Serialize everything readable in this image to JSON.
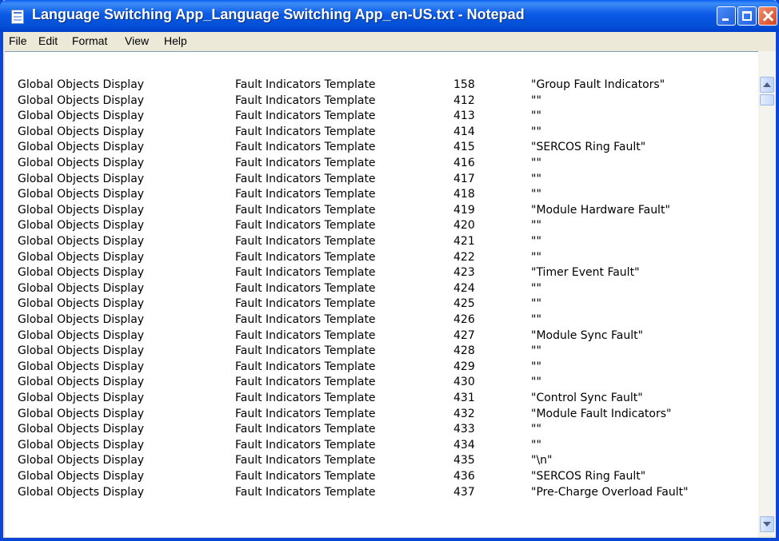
{
  "window": {
    "title": "Language Switching App_Language Switching App_en-US.txt - Notepad",
    "buttons": [
      "minimize",
      "maximize",
      "close"
    ]
  },
  "menu": [
    "File",
    "Edit",
    "Format",
    "View",
    "Help"
  ],
  "colors": {
    "titlebar": "#0b5ae6",
    "close_button": "#d8431c",
    "menubar": "#ece9d8"
  },
  "content": {
    "lines": [
      [
        "Global Objects Display",
        "Fault Indicators Template",
        "158",
        "\"Group Fault Indicators\""
      ],
      [
        "Global Objects Display",
        "Fault Indicators Template",
        "412",
        "\"\""
      ],
      [
        "Global Objects Display",
        "Fault Indicators Template",
        "413",
        "\"\""
      ],
      [
        "Global Objects Display",
        "Fault Indicators Template",
        "414",
        "\"\""
      ],
      [
        "Global Objects Display",
        "Fault Indicators Template",
        "415",
        "\"SERCOS Ring Fault\""
      ],
      [
        "Global Objects Display",
        "Fault Indicators Template",
        "416",
        "\"\""
      ],
      [
        "Global Objects Display",
        "Fault Indicators Template",
        "417",
        "\"\""
      ],
      [
        "Global Objects Display",
        "Fault Indicators Template",
        "418",
        "\"\""
      ],
      [
        "Global Objects Display",
        "Fault Indicators Template",
        "419",
        "\"Module Hardware Fault\""
      ],
      [
        "Global Objects Display",
        "Fault Indicators Template",
        "420",
        "\"\""
      ],
      [
        "Global Objects Display",
        "Fault Indicators Template",
        "421",
        "\"\""
      ],
      [
        "Global Objects Display",
        "Fault Indicators Template",
        "422",
        "\"\""
      ],
      [
        "Global Objects Display",
        "Fault Indicators Template",
        "423",
        "\"Timer Event Fault\""
      ],
      [
        "Global Objects Display",
        "Fault Indicators Template",
        "424",
        "\"\""
      ],
      [
        "Global Objects Display",
        "Fault Indicators Template",
        "425",
        "\"\""
      ],
      [
        "Global Objects Display",
        "Fault Indicators Template",
        "426",
        "\"\""
      ],
      [
        "Global Objects Display",
        "Fault Indicators Template",
        "427",
        "\"Module Sync Fault\""
      ],
      [
        "Global Objects Display",
        "Fault Indicators Template",
        "428",
        "\"\""
      ],
      [
        "Global Objects Display",
        "Fault Indicators Template",
        "429",
        "\"\""
      ],
      [
        "Global Objects Display",
        "Fault Indicators Template",
        "430",
        "\"\""
      ],
      [
        "Global Objects Display",
        "Fault Indicators Template",
        "431",
        "\"Control Sync Fault\""
      ],
      [
        "Global Objects Display",
        "Fault Indicators Template",
        "432",
        "\"Module Fault Indicators\""
      ],
      [
        "Global Objects Display",
        "Fault Indicators Template",
        "433",
        "\"\""
      ],
      [
        "Global Objects Display",
        "Fault Indicators Template",
        "434",
        "\"\""
      ],
      [
        "Global Objects Display",
        "Fault Indicators Template",
        "435",
        "\"\\n\""
      ],
      [
        "Global Objects Display",
        "Fault Indicators Template",
        "436",
        "\"SERCOS Ring Fault\""
      ],
      [
        "Global Objects Display",
        "Fault Indicators Template",
        "437",
        "\"Pre-Charge Overload Fault\""
      ]
    ]
  }
}
